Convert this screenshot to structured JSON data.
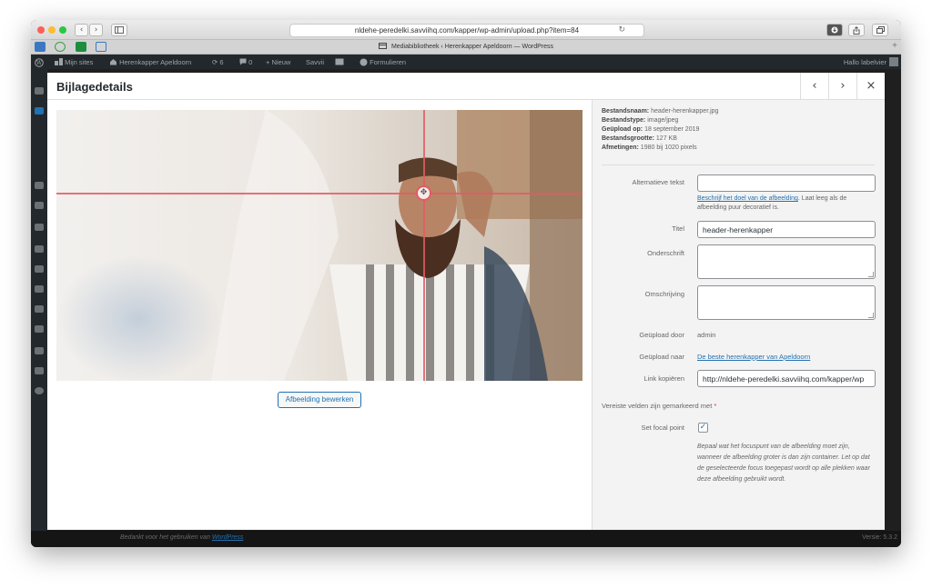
{
  "browser": {
    "url": "nldehe-peredelki.savviihq.com/kapper/wp-admin/upload.php?item=84",
    "tab_title": "Mediabibliotheek ‹ Herenkapper Apeldoorn — WordPress",
    "back_glyph": "‹",
    "forward_glyph": "›",
    "reload_glyph": "↻",
    "plus_glyph": "+"
  },
  "adminbar": {
    "mijn_sites": "Mijn sites",
    "site_name": "Herenkapper Apeldoorn",
    "updates": "6",
    "comments": "0",
    "nieuw": "+ Nieuw",
    "savvii": "Savvii",
    "formulieren": "Formulieren",
    "greeting": "Hallo labelvier"
  },
  "footer": {
    "thanks_text": "Bedankt voor het gebruiken van",
    "thanks_link": "WordPress",
    "version": "Versie: 5.3.2"
  },
  "modal": {
    "title": "Bijlagedetails",
    "prev_glyph": "‹",
    "next_glyph": "›",
    "close_glyph": "×",
    "edit_image_button": "Afbeelding bewerken",
    "focal_handle_glyph": "✥"
  },
  "file_info": {
    "filename_label": "Bestandsnaam:",
    "filename": "header-herenkapper.jpg",
    "filetype_label": "Bestandstype:",
    "filetype": "image/jpeg",
    "uploaded_on_label": "Geüpload op:",
    "uploaded_on": "18 september 2019",
    "filesize_label": "Bestandsgrootte:",
    "filesize": "127 KB",
    "dimensions_label": "Afmetingen:",
    "dimensions": "1980 bij 1020 pixels"
  },
  "fields": {
    "alt_label": "Alternatieve tekst",
    "alt_value": "",
    "alt_help_link": "Beschrijf het doel van de afbeelding",
    "alt_help_text": ". Laat leeg als de afbeelding puur decoratief is.",
    "title_label": "Titel",
    "title_value": "header-herenkapper",
    "caption_label": "Onderschrift",
    "caption_value": "",
    "description_label": "Omschrijving",
    "description_value": "",
    "uploaded_by_label": "Geüpload door",
    "uploaded_by": "admin",
    "uploaded_to_label": "Geüpload naar",
    "uploaded_to": "De beste herenkapper van Apeldoorn",
    "copy_link_label": "Link kopiëren",
    "copy_link_value": "http://nldehe-peredelki.savviihq.com/kapper/wp"
  },
  "required_note": "Vereiste velden zijn gemarkeerd met",
  "required_star": "*",
  "focal_point": {
    "label": "Set focal point",
    "checked": true,
    "check_glyph": "✓",
    "description": "Bepaal wat het focuspunt van de afbeelding moet zijn, wanneer de afbeelding groter is dan zijn container. Let op dat de geselecteerde focus toegepast wordt op alle plekken waar deze afbeelding gebruikt wordt."
  },
  "colors": {
    "focal_line": "#e05c64",
    "link": "#2271b1",
    "adminbar": "#23282d"
  }
}
